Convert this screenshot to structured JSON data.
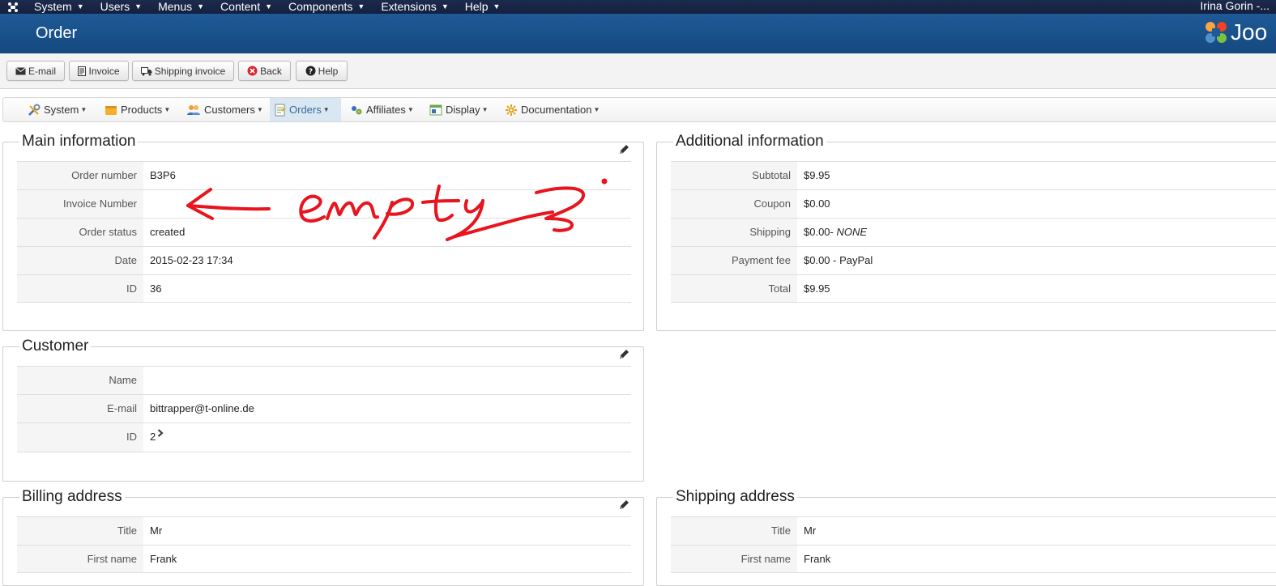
{
  "topnav": {
    "items": [
      {
        "label": "System"
      },
      {
        "label": "Users"
      },
      {
        "label": "Menus"
      },
      {
        "label": "Content"
      },
      {
        "label": "Components"
      },
      {
        "label": "Extensions"
      },
      {
        "label": "Help"
      }
    ],
    "user": "Irina Gorin -..."
  },
  "header": {
    "title": "Order",
    "brand": "Joo"
  },
  "toolbar": {
    "email": "E-mail",
    "invoice": "Invoice",
    "shipping_invoice": "Shipping invoice",
    "back": "Back",
    "help": "Help"
  },
  "component_menu": {
    "items": [
      {
        "label": "System"
      },
      {
        "label": "Products"
      },
      {
        "label": "Customers"
      },
      {
        "label": "Orders"
      },
      {
        "label": "Affiliates"
      },
      {
        "label": "Display"
      },
      {
        "label": "Documentation"
      }
    ]
  },
  "main_information": {
    "title": "Main information",
    "rows": [
      {
        "label": "Order number",
        "value": "B3P6"
      },
      {
        "label": "Invoice Number",
        "value": ""
      },
      {
        "label": "Order status",
        "value": "created"
      },
      {
        "label": "Date",
        "value": "2015-02-23 17:34"
      },
      {
        "label": "ID",
        "value": "36"
      }
    ]
  },
  "additional_information": {
    "title": "Additional information",
    "rows": [
      {
        "label": "Subtotal",
        "value": "$9.95"
      },
      {
        "label": "Coupon",
        "value": "$0.00"
      },
      {
        "label": "Shipping",
        "value": "$0.00-",
        "value_italic": "NONE"
      },
      {
        "label": "Payment fee",
        "value": "$0.00 - PayPal"
      },
      {
        "label": "Total",
        "value": "$9.95"
      }
    ]
  },
  "customer": {
    "title": "Customer",
    "rows": [
      {
        "label": "Name",
        "value": ""
      },
      {
        "label": "E-mail",
        "value": "bittrapper@t-online.de"
      },
      {
        "label": "ID",
        "value": "2"
      }
    ]
  },
  "billing_address": {
    "title": "Billing address",
    "rows": [
      {
        "label": "Title",
        "value": "Mr"
      },
      {
        "label": "First name",
        "value": "Frank"
      }
    ]
  },
  "shipping_address": {
    "title": "Shipping address",
    "rows": [
      {
        "label": "Title",
        "value": "Mr"
      },
      {
        "label": "First name",
        "value": "Frank"
      }
    ]
  },
  "annotation": {
    "color": "#e8141e"
  },
  "colors": {
    "header_blue": "#1e5a97",
    "topnav_dark": "#1c2a4d",
    "menu_active": "#d9e7f3"
  },
  "icons": [
    "joomla-icon",
    "envelope-icon",
    "document-icon",
    "truck-icon",
    "back-icon",
    "help-icon",
    "tools-icon",
    "products-icon",
    "customers-icon",
    "orders-icon",
    "affiliates-icon",
    "display-icon",
    "documentation-icon",
    "pencil-icon",
    "chevron-right-icon"
  ]
}
